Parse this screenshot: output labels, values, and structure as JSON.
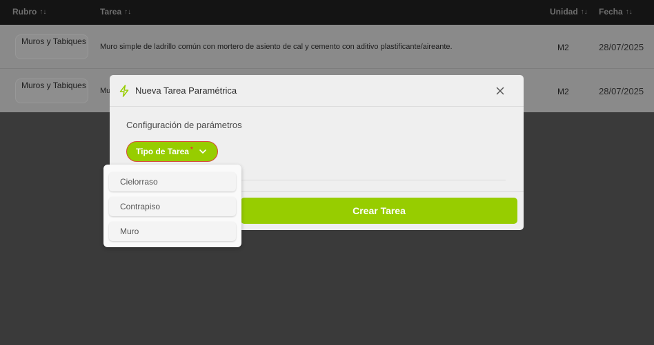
{
  "table": {
    "headers": {
      "rubro": "Rubro",
      "tarea": "Tarea",
      "unidad": "Unidad",
      "fecha": "Fecha",
      "sort_icon": "↑↓"
    },
    "rows": [
      {
        "rubro": "Muros y Tabiques",
        "tarea": "Muro simple de ladrillo común con mortero de asiento de cal y cemento con aditivo plastificante/aireante.",
        "unidad": "M2",
        "fecha": "28/07/2025"
      },
      {
        "rubro": "Muros y Tabiques",
        "tarea": "Mu",
        "unidad": "M2",
        "fecha": "28/07/2025"
      }
    ]
  },
  "modal": {
    "title": "Nueva Tarea Paramétrica",
    "section_title": "Configuración de parámetros",
    "tipo_label": "Tipo de Tarea",
    "required_mark": "*",
    "create_label": "Crear Tarea",
    "icons": {
      "title": "lightning-bolt-icon",
      "close": "close-icon",
      "chevron": "chevron-down-icon"
    }
  },
  "dropdown": {
    "options": [
      "Cielorraso",
      "Contrapiso",
      "Muro"
    ]
  },
  "colors": {
    "accent": "#97cd00",
    "required": "#e33b2a",
    "header_bg": "#141414",
    "overlay_bg": "#3a3a3a"
  }
}
